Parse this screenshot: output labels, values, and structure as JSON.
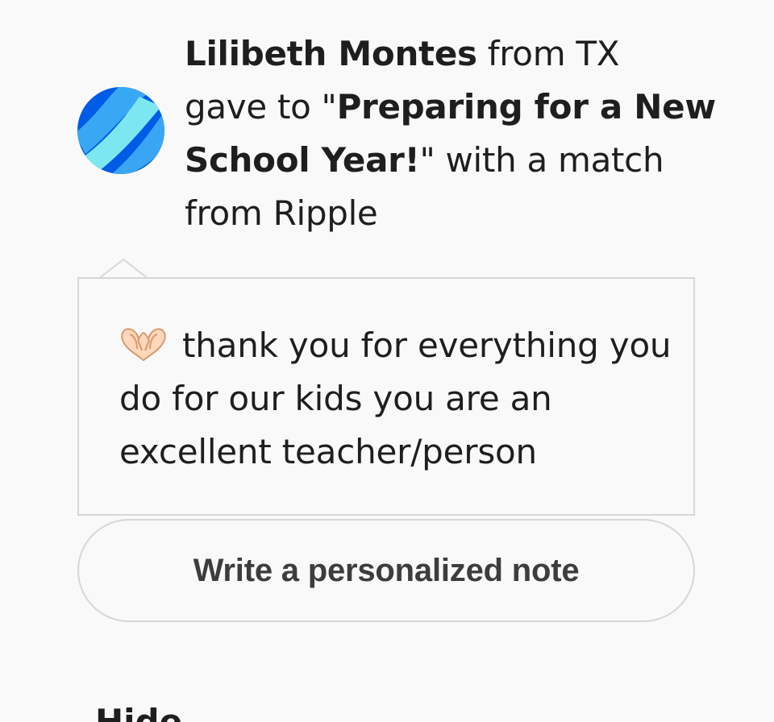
{
  "activity": {
    "donor_name": "Lilibeth Montes",
    "text_from": "from TX",
    "text_gave_to": "gave to \"",
    "project_title": "Preparing for a New School Year!",
    "text_match": "\" with a match from Ripple"
  },
  "note": {
    "emoji_icon": "heart-hands-icon",
    "message": "thank you for everything you do for our kids you are an excellent teacher/person"
  },
  "actions": {
    "write_note_label": "Write a personalized note",
    "hide_label": "Hide"
  },
  "colors": {
    "background": "#f9f9f9",
    "avatar_dark_blue": "#005be6",
    "avatar_light_blue": "#7ce7f1",
    "text": "#1e1e1e",
    "border": "#d7d7d7"
  }
}
